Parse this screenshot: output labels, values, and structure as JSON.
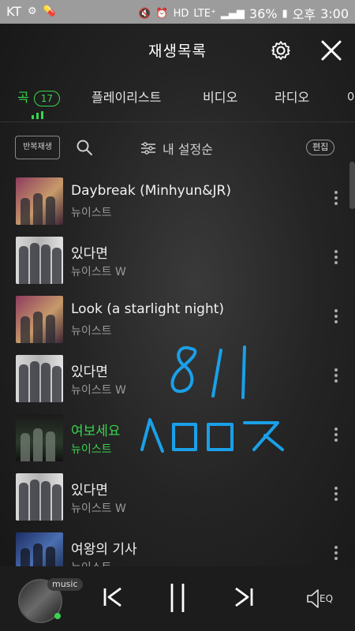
{
  "status": {
    "carrier": "KT",
    "battery": "36%",
    "ampm": "오후",
    "time": "3:00",
    "lte": "LTE⁺"
  },
  "header": {
    "title": "재생목록"
  },
  "tabs": [
    {
      "label": "곡",
      "count": "17"
    },
    {
      "label": "플레이리스트"
    },
    {
      "label": "비디오"
    },
    {
      "label": "라디오"
    },
    {
      "label": "아"
    }
  ],
  "toolbar": {
    "repeat_label": "반복재생",
    "sort_label": "내 설정순",
    "edit_label": "편집"
  },
  "songs": [
    {
      "title": "Daybreak (Minhyun&JR)",
      "artist": "뉴이스트"
    },
    {
      "title": "있다면",
      "artist": "뉴이스트 W"
    },
    {
      "title": "Look (a starlight night)",
      "artist": "뉴이스트"
    },
    {
      "title": "있다면",
      "artist": "뉴이스트 W"
    },
    {
      "title": "여보세요",
      "artist": "뉴이스트"
    },
    {
      "title": "있다면",
      "artist": "뉴이스트 W"
    },
    {
      "title": "여왕의 기사",
      "artist": "뉴이스트"
    }
  ],
  "player": {
    "badge": "music",
    "eq_label": "EQ"
  },
  "colors": {
    "accent": "#38d44f",
    "handwriting": "#1aa0e8"
  }
}
